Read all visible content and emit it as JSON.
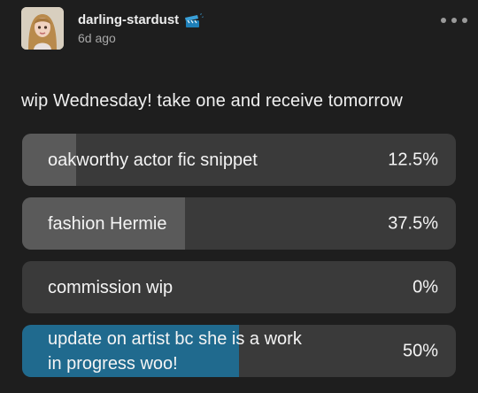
{
  "post": {
    "username": "darling-stardust",
    "timestamp": "6d ago",
    "avatar_icon": "avatar-illustration",
    "badge_icon": "clapper-badge-icon",
    "more_icon": "more-dots-icon"
  },
  "poll": {
    "question": "wip Wednesday! take one and receive tomorrow",
    "options": [
      {
        "label": "oakworthy actor fic snippet",
        "percent_label": "12.5%",
        "fraction": 0.125,
        "leader": false
      },
      {
        "label": "fashion Hermie",
        "percent_label": "37.5%",
        "fraction": 0.375,
        "leader": false
      },
      {
        "label": "commission wip",
        "percent_label": "0%",
        "fraction": 0.0,
        "leader": false
      },
      {
        "label": "update on artist bc she is a work in progress woo!",
        "percent_label": "50%",
        "fraction": 0.5,
        "leader": true
      }
    ]
  },
  "colors": {
    "background": "#1e1e1e",
    "option_bg": "#3a3a3a",
    "option_fill": "#5a5a5a",
    "leader_fill": "#206a8e"
  }
}
